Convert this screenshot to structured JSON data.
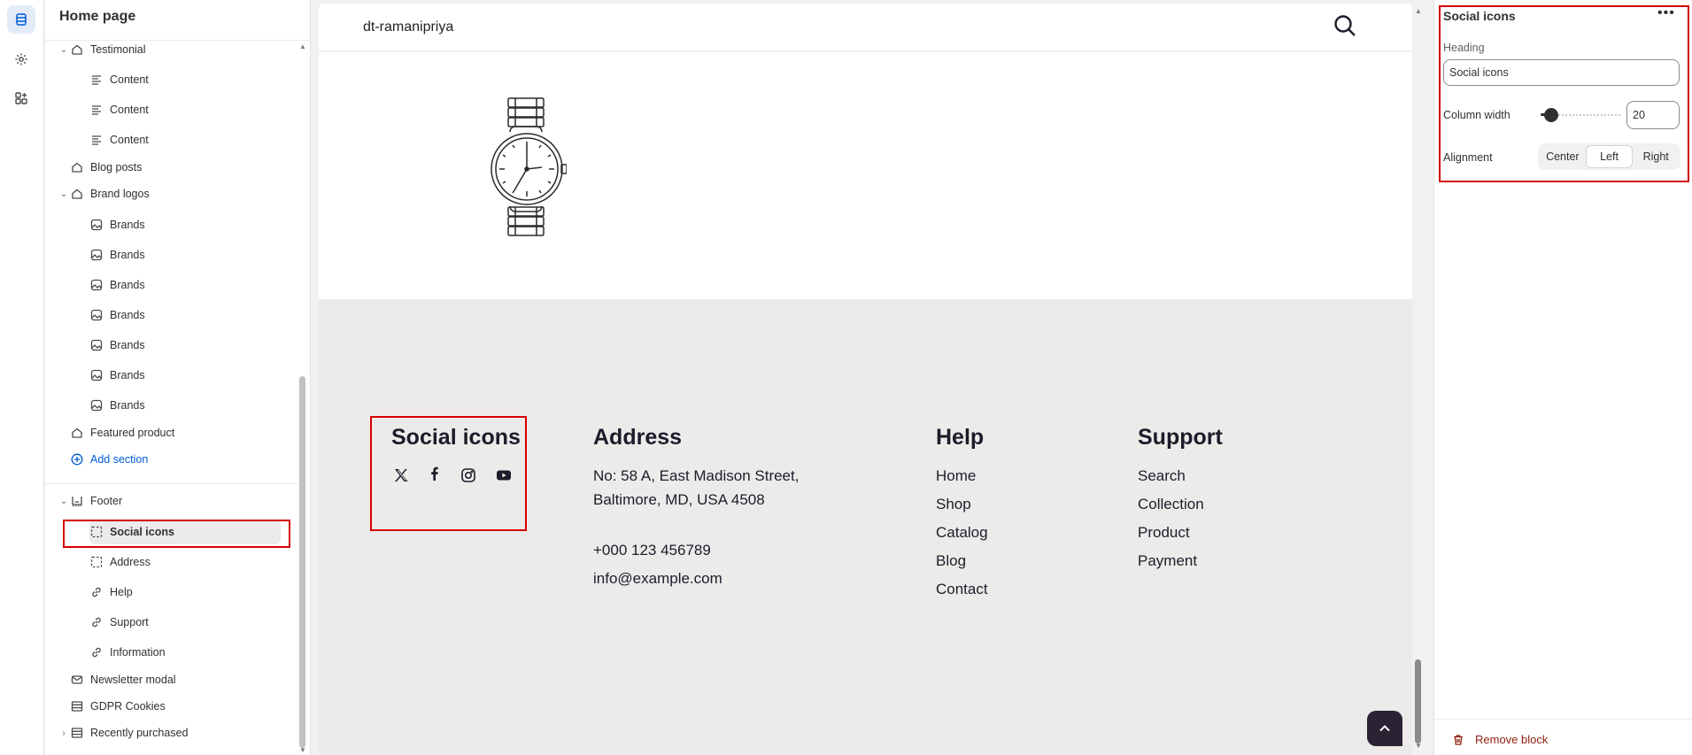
{
  "sidebar": {
    "title": "Home page",
    "items": [
      {
        "label": "Testimonial",
        "icon": "section-icon",
        "level": 0,
        "chevron": "down"
      },
      {
        "label": "Content",
        "icon": "text-block-icon",
        "level": 1
      },
      {
        "label": "Content",
        "icon": "text-block-icon",
        "level": 1
      },
      {
        "label": "Content",
        "icon": "text-block-icon",
        "level": 1
      },
      {
        "label": "Blog posts",
        "icon": "section-icon",
        "level": 0
      },
      {
        "label": "Brand logos",
        "icon": "section-icon",
        "level": 0,
        "chevron": "down"
      },
      {
        "label": "Brands",
        "icon": "image-icon",
        "level": 1
      },
      {
        "label": "Brands",
        "icon": "image-icon",
        "level": 1
      },
      {
        "label": "Brands",
        "icon": "image-icon",
        "level": 1
      },
      {
        "label": "Brands",
        "icon": "image-icon",
        "level": 1
      },
      {
        "label": "Brands",
        "icon": "image-icon",
        "level": 1
      },
      {
        "label": "Brands",
        "icon": "image-icon",
        "level": 1
      },
      {
        "label": "Brands",
        "icon": "image-icon",
        "level": 1
      },
      {
        "label": "Featured product",
        "icon": "section-icon",
        "level": 0
      }
    ],
    "add_section": "Add section",
    "footer_items": [
      {
        "label": "Footer",
        "icon": "footer-icon",
        "level": 0,
        "chevron": "down"
      },
      {
        "label": "Social icons",
        "icon": "block-icon",
        "level": 1,
        "selected": true
      },
      {
        "label": "Address",
        "icon": "block-icon",
        "level": 1
      },
      {
        "label": "Help",
        "icon": "link-icon",
        "level": 1
      },
      {
        "label": "Support",
        "icon": "link-icon",
        "level": 1
      },
      {
        "label": "Information",
        "icon": "link-icon",
        "level": 1
      }
    ],
    "bottom_items": [
      {
        "label": "Newsletter modal",
        "icon": "mail-icon",
        "level": 0
      },
      {
        "label": "GDPR Cookies",
        "icon": "app-block-icon",
        "level": 0
      },
      {
        "label": "Recently purchased",
        "icon": "app-block-icon",
        "level": 0,
        "chevron": "right"
      }
    ]
  },
  "preview": {
    "store_name": "dt-ramanipriya",
    "footer": {
      "social": {
        "title": "Social icons",
        "icons": [
          "x-icon",
          "facebook-icon",
          "instagram-icon",
          "youtube-icon"
        ]
      },
      "address": {
        "title": "Address",
        "line1": "No: 58 A, East Madison Street,",
        "line2": "Baltimore, MD, USA 4508",
        "phone": "+000 123 456789",
        "email": "info@example.com"
      },
      "help": {
        "title": "Help",
        "links": [
          "Home",
          "Shop",
          "Catalog",
          "Blog",
          "Contact"
        ]
      },
      "support": {
        "title": "Support",
        "links": [
          "Search",
          "Collection",
          "Product",
          "Payment"
        ]
      }
    }
  },
  "settings": {
    "title": "Social icons",
    "heading_label": "Heading",
    "heading_value": "Social icons",
    "column_width_label": "Column width",
    "column_width_value": "20",
    "alignment_label": "Alignment",
    "alignment_options": [
      "Center",
      "Left",
      "Right"
    ],
    "alignment_selected": "Left",
    "remove_label": "Remove block"
  },
  "colors": {
    "highlight": "#d40000",
    "accent_link": "#005bd3",
    "footer_bg": "#edebe9",
    "remove": "#8e1f0b"
  }
}
